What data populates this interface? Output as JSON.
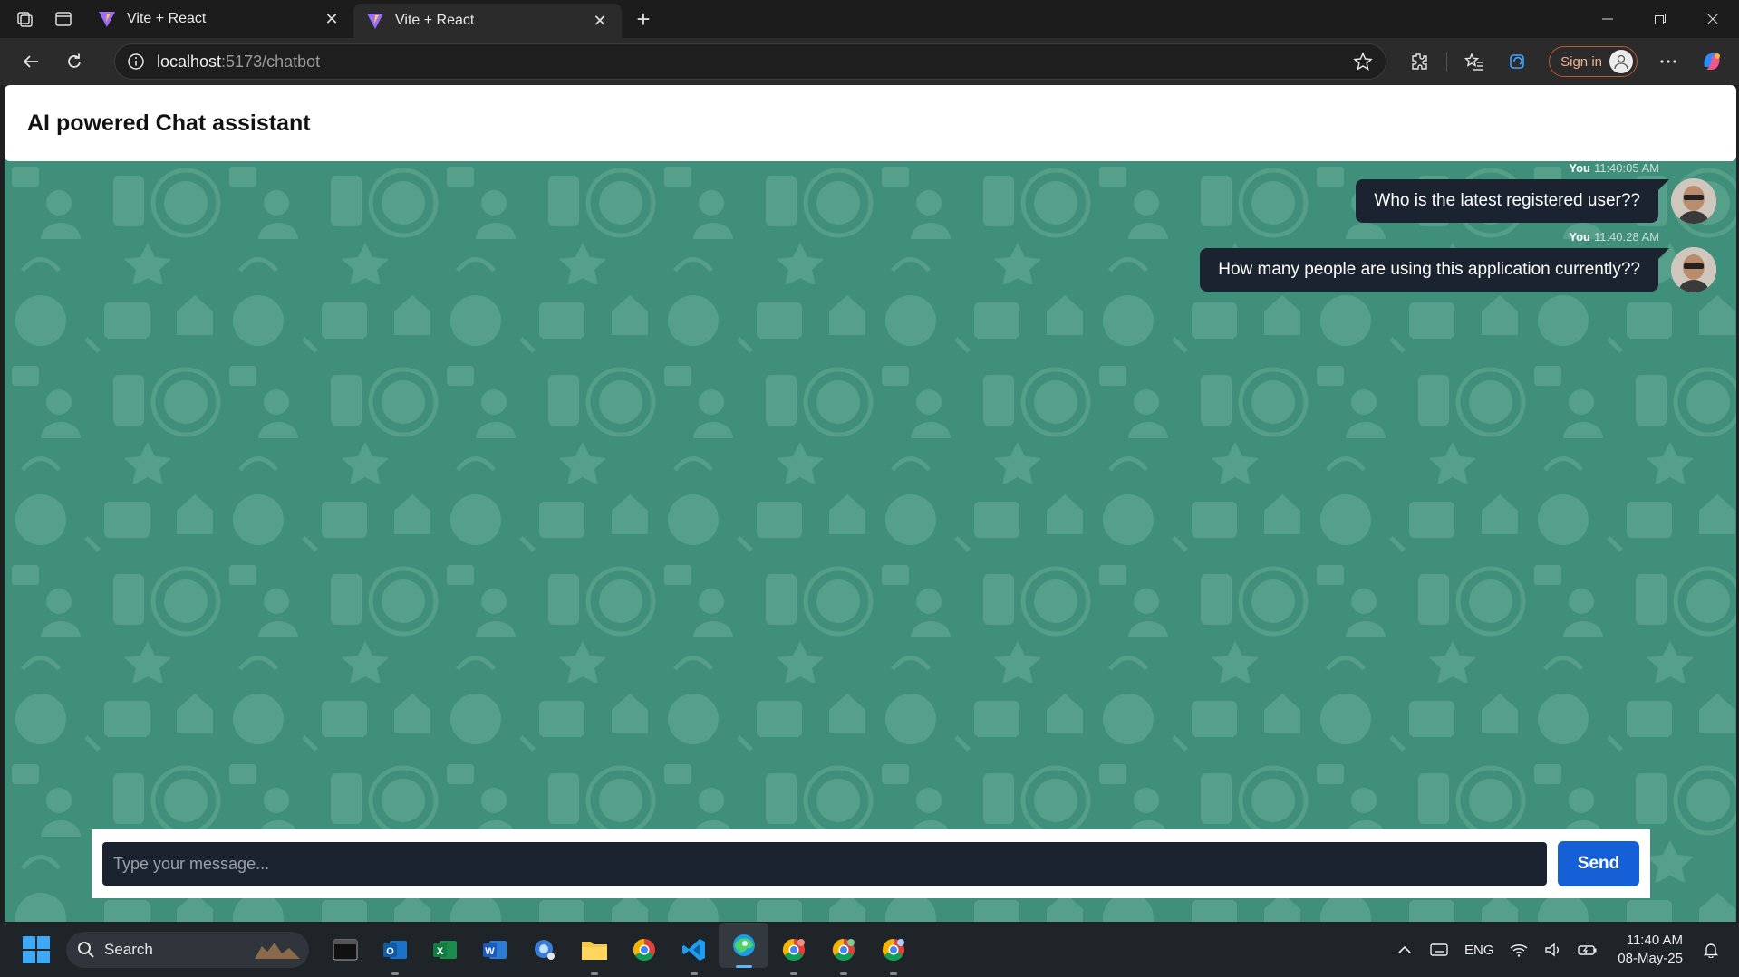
{
  "browser": {
    "tabs": [
      {
        "title": "Vite + React",
        "active": false
      },
      {
        "title": "Vite + React",
        "active": true
      }
    ],
    "address": {
      "host": "localhost",
      "path": ":5173/chatbot"
    },
    "signin_label": "Sign in"
  },
  "page": {
    "title": "AI powered Chat assistant",
    "background_color": "#3f8f7a",
    "messages": [
      {
        "sender": "You",
        "time": "11:40:05 AM",
        "text": "Who is the latest registered user??"
      },
      {
        "sender": "You",
        "time": "11:40:28 AM",
        "text": "How many people are using this application currently??"
      }
    ],
    "composer": {
      "placeholder": "Type your message...",
      "send_label": "Send",
      "send_color": "#1560d6"
    }
  },
  "taskbar": {
    "search_label": "Search",
    "apps": [
      "terminal",
      "outlook",
      "excel",
      "word",
      "remote-assist",
      "file-explorer",
      "chrome",
      "vscode",
      "edge",
      "chrome-profile-1",
      "chrome-profile-2",
      "chrome-profile-3"
    ],
    "tray": {
      "language": "ENG",
      "time": "11:40 AM",
      "date": "08-May-25"
    }
  }
}
